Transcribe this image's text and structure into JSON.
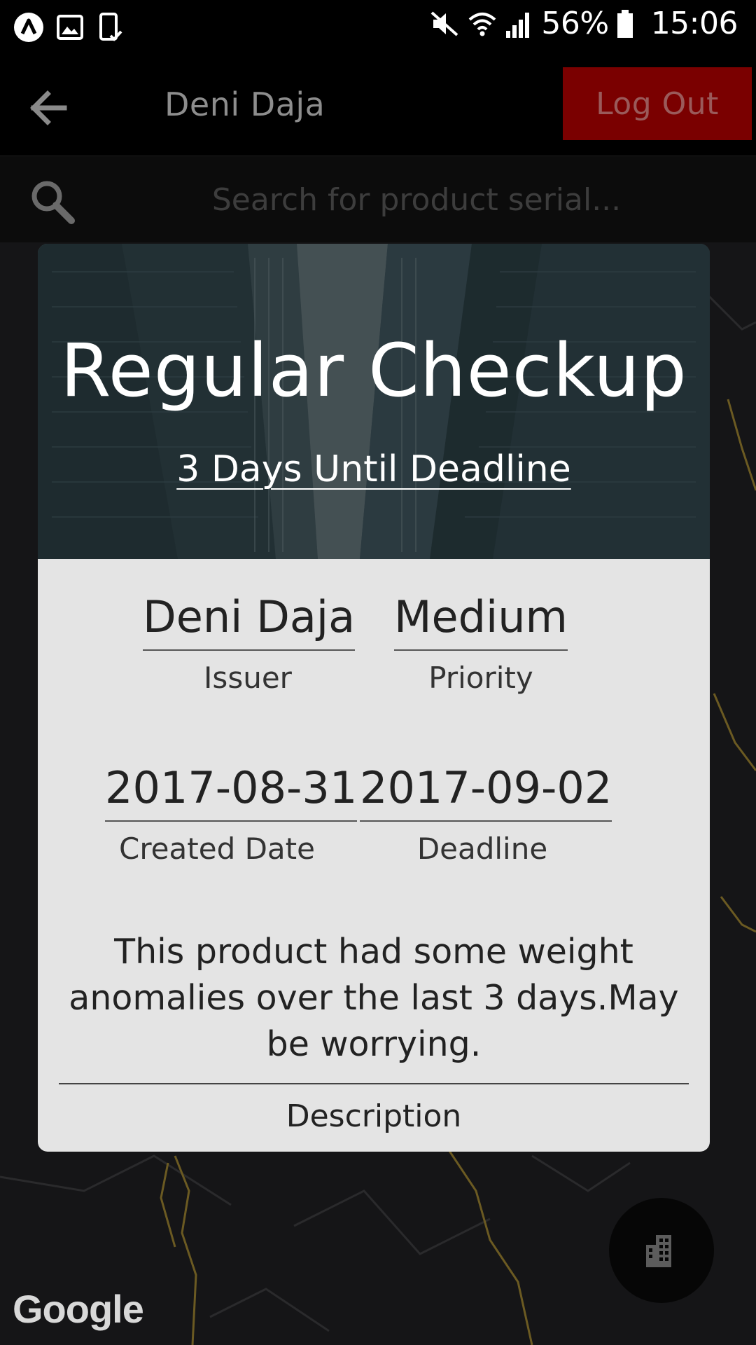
{
  "status_bar": {
    "left_icons": [
      "app-icon",
      "gallery-icon",
      "phone-check-icon"
    ],
    "right_icons": [
      "mute-icon",
      "wifi-icon",
      "signal-icon",
      "battery-icon"
    ],
    "battery": "56%",
    "time": "15:06"
  },
  "app_bar": {
    "title": "Deni Daja",
    "logout_label": "Log Out",
    "colors": {
      "logout_bg": "#7a0000"
    }
  },
  "search": {
    "placeholder": "Search for product serial..."
  },
  "card": {
    "title": "Regular Checkup",
    "subtitle": "3 Days Until Deadline",
    "issuer": {
      "value": "Deni Daja",
      "label": "Issuer"
    },
    "priority": {
      "value": "Medium",
      "label": "Priority"
    },
    "created": {
      "value": "2017-08-31",
      "label": "Created Date"
    },
    "deadline": {
      "value": "2017-09-02",
      "label": "Deadline"
    },
    "description": {
      "text": "This product had some weight anomalies over the last 3 days.May be worrying.",
      "label": "Description"
    }
  },
  "fab": {
    "icon": "building-icon"
  },
  "map": {
    "attribution": "Google"
  }
}
